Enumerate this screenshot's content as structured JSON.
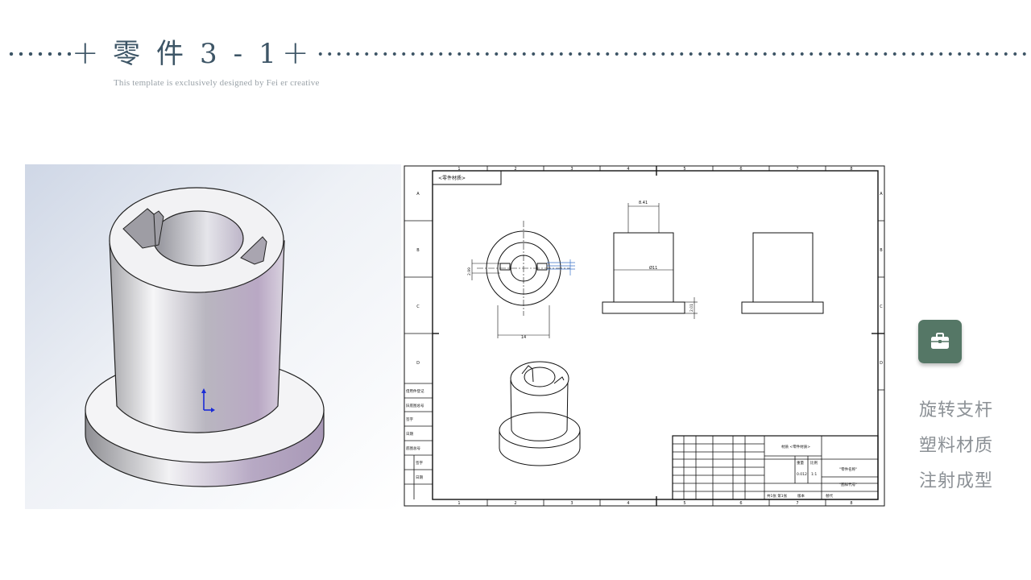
{
  "header": {
    "title": "零件3-1",
    "subtitle": "This template is exclusively designed by Fei er creative"
  },
  "drawing": {
    "tag_label": "<零件材质>",
    "border_letters": [
      "A",
      "B",
      "C",
      "D"
    ],
    "border_numbers": [
      "1",
      "2",
      "3",
      "4",
      "5",
      "6",
      "7",
      "8"
    ],
    "dimension_top": "8.41",
    "dimension_bottom": "14",
    "dimension_diameter": "Ø11",
    "dimension_side": "2.99",
    "dimension_flange": "2.01",
    "left_block_labels": [
      "借用件登记",
      "旧底图总号",
      "签字",
      "日期",
      "底图总号",
      "签字",
      "日期"
    ],
    "title_block": {
      "material": "材质 <零件材质>",
      "weight_scale": [
        "重量",
        "比例"
      ],
      "scale_value": "1:1",
      "weight_value": "0.012",
      "part_name": "\"零件名称\"",
      "part_number": "\"图样代号\"",
      "sheet": "共1张 第1张",
      "version": "版本",
      "replace": "替代"
    }
  },
  "badge": {
    "icon": "briefcase-icon",
    "color": "#557766"
  },
  "features": [
    "旋转支杆",
    "塑料材质",
    "注射成型"
  ]
}
